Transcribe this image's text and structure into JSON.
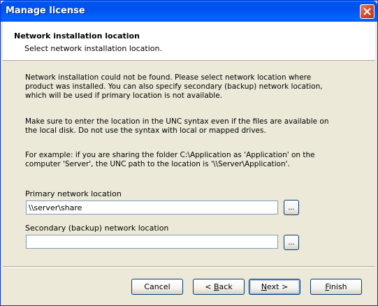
{
  "window": {
    "title": "Manage license"
  },
  "header": {
    "title": "Network installation location",
    "subtitle": "Select network installation location."
  },
  "body": {
    "paragraph1": "Network installation could not be found. Please select network location where product was installed. You can also specify secondary (backup) network location, which will be used if primary location is not available.",
    "paragraph2": "Make sure to enter the location in the UNC syntax even if the files are available on the local disk. Do not use the syntax with local or mapped drives.",
    "paragraph3": "For example: if you are sharing the folder C:\\Application as 'Application' on the computer 'Server', the UNC path to the location is '\\\\Server\\Application'."
  },
  "primary": {
    "label": "Primary network location",
    "value": "\\\\server\\share",
    "browse_label": "..."
  },
  "secondary": {
    "label": "Secondary (backup) network location",
    "value": "",
    "browse_label": "..."
  },
  "buttons": {
    "cancel": "Cancel",
    "back_mnemonic": "B",
    "back_prefix": "< ",
    "back_rest": "ack",
    "next_mnemonic": "N",
    "next_rest": "ext >",
    "finish_mnemonic": "F",
    "finish_rest": "inish"
  },
  "icons": {
    "close": "close-icon"
  },
  "colors": {
    "titlebar": "#0054e3",
    "dialog_bg": "#ece9d8",
    "close_button": "#d9482a"
  }
}
